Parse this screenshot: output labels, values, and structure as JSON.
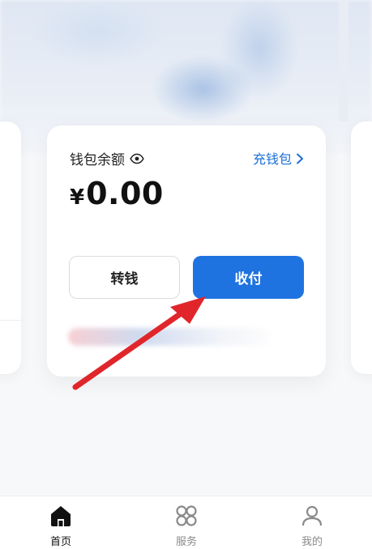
{
  "wallet": {
    "balance_label": "钱包余额",
    "topup_label": "充钱包",
    "currency_symbol": "¥",
    "amount": "0.00",
    "transfer_label": "转钱",
    "receive_label": "收付"
  },
  "tabs": [
    {
      "label": "首页",
      "icon": "home-icon",
      "active": true
    },
    {
      "label": "服务",
      "icon": "grid-icon",
      "active": false
    },
    {
      "label": "我的",
      "icon": "user-icon",
      "active": false
    }
  ],
  "colors": {
    "accent": "#1f73e0",
    "link": "#1a6fd6",
    "annotation": "#e0262b"
  }
}
